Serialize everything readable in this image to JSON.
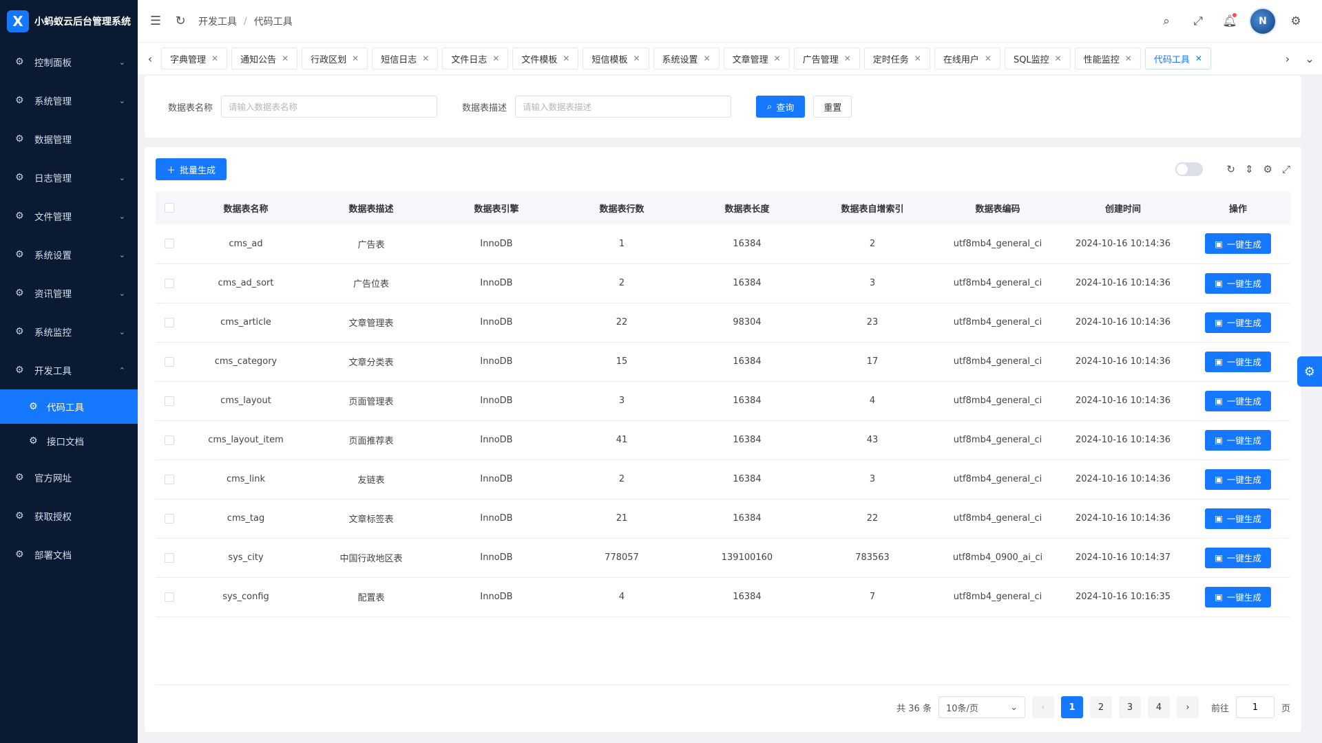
{
  "app": {
    "title": "小蚂蚁云后台管理系统",
    "logo_letter": "X"
  },
  "sidebar": {
    "items": [
      {
        "label": "控制面板",
        "icon": "⚙",
        "chevron": "⌄"
      },
      {
        "label": "系统管理",
        "icon": "⚙",
        "chevron": "⌄"
      },
      {
        "label": "数据管理",
        "icon": "⚙",
        "chevron": ""
      },
      {
        "label": "日志管理",
        "icon": "⚙",
        "chevron": "⌄"
      },
      {
        "label": "文件管理",
        "icon": "⚙",
        "chevron": "⌄"
      },
      {
        "label": "系统设置",
        "icon": "⚙",
        "chevron": "⌄"
      },
      {
        "label": "资讯管理",
        "icon": "⚙",
        "chevron": "⌄"
      },
      {
        "label": "系统监控",
        "icon": "⚙",
        "chevron": "⌄"
      },
      {
        "label": "开发工具",
        "icon": "⚙",
        "chevron": "⌃"
      }
    ],
    "sub_items": [
      {
        "label": "代码工具",
        "icon": "⚙"
      },
      {
        "label": "接口文档",
        "icon": "⚙"
      }
    ],
    "bottom_items": [
      {
        "label": "官方网址",
        "icon": "⚙"
      },
      {
        "label": "获取授权",
        "icon": "⚙"
      },
      {
        "label": "部署文档",
        "icon": "⚙"
      }
    ]
  },
  "header": {
    "breadcrumb": [
      "开发工具",
      "代码工具"
    ],
    "breadcrumb_sep": "/",
    "avatar_text": "N"
  },
  "tabs": [
    "字典管理",
    "通知公告",
    "行政区划",
    "短信日志",
    "文件日志",
    "文件模板",
    "短信模板",
    "系统设置",
    "文章管理",
    "广告管理",
    "定时任务",
    "在线用户",
    "SQL监控",
    "性能监控",
    "代码工具"
  ],
  "search": {
    "name_label": "数据表名称",
    "name_placeholder": "请输入数据表名称",
    "desc_label": "数据表描述",
    "desc_placeholder": "请输入数据表描述",
    "query_button": "查询",
    "reset_button": "重置"
  },
  "toolbar": {
    "batch_button": "批量生成"
  },
  "table": {
    "headers": [
      "数据表名称",
      "数据表描述",
      "数据表引擎",
      "数据表行数",
      "数据表长度",
      "数据表自增索引",
      "数据表编码",
      "创建时间",
      "操作"
    ],
    "action_label": "一键生成",
    "rows": [
      [
        "cms_ad",
        "广告表",
        "InnoDB",
        "1",
        "16384",
        "2",
        "utf8mb4_general_ci",
        "2024-10-16 10:14:36"
      ],
      [
        "cms_ad_sort",
        "广告位表",
        "InnoDB",
        "2",
        "16384",
        "3",
        "utf8mb4_general_ci",
        "2024-10-16 10:14:36"
      ],
      [
        "cms_article",
        "文章管理表",
        "InnoDB",
        "22",
        "98304",
        "23",
        "utf8mb4_general_ci",
        "2024-10-16 10:14:36"
      ],
      [
        "cms_category",
        "文章分类表",
        "InnoDB",
        "15",
        "16384",
        "17",
        "utf8mb4_general_ci",
        "2024-10-16 10:14:36"
      ],
      [
        "cms_layout",
        "页面管理表",
        "InnoDB",
        "3",
        "16384",
        "4",
        "utf8mb4_general_ci",
        "2024-10-16 10:14:36"
      ],
      [
        "cms_layout_item",
        "页面推荐表",
        "InnoDB",
        "41",
        "16384",
        "43",
        "utf8mb4_general_ci",
        "2024-10-16 10:14:36"
      ],
      [
        "cms_link",
        "友链表",
        "InnoDB",
        "2",
        "16384",
        "3",
        "utf8mb4_general_ci",
        "2024-10-16 10:14:36"
      ],
      [
        "cms_tag",
        "文章标签表",
        "InnoDB",
        "21",
        "16384",
        "22",
        "utf8mb4_general_ci",
        "2024-10-16 10:14:36"
      ],
      [
        "sys_city",
        "中国行政地区表",
        "InnoDB",
        "778057",
        "139100160",
        "783563",
        "utf8mb4_0900_ai_ci",
        "2024-10-16 10:14:37"
      ],
      [
        "sys_config",
        "配置表",
        "InnoDB",
        "4",
        "16384",
        "7",
        "utf8mb4_general_ci",
        "2024-10-16 10:16:35"
      ]
    ]
  },
  "pagination": {
    "total": "共 36 条",
    "page_size": "10条/页",
    "pages": [
      "1",
      "2",
      "3",
      "4"
    ],
    "current": "1",
    "goto_label": "前往",
    "goto_value": "1",
    "page_suffix": "页"
  },
  "colors": {
    "primary": "#1677ff",
    "sidebar_bg": "#0b1a33"
  }
}
